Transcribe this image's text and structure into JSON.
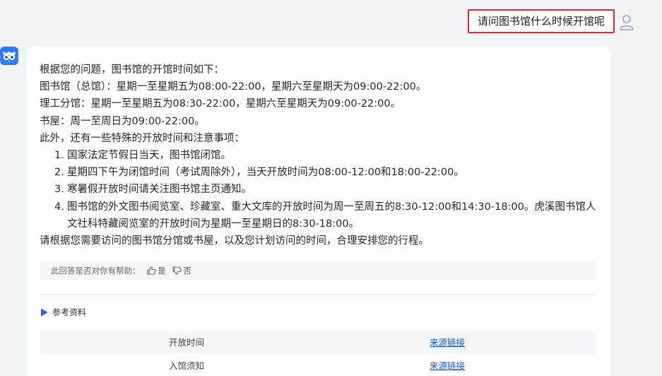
{
  "user": {
    "question": "请问图书馆什么时候开馆呢",
    "avatar_icon": "user-icon"
  },
  "bot": {
    "avatar_icon": "owl-logo-icon"
  },
  "answer": {
    "intro": "根据您的问题，图书馆的开馆时间如下：",
    "lines": [
      "图书馆（总馆）：星期一至星期五为08:00-22:00，星期六至星期天为09:00-22:00。",
      "理工分馆：星期一至星期五为08:30-22:00，星期六至星期天为09:00-22:00。",
      "书屋：周一至周日为09:00-22:00。",
      "此外，还有一些特殊的开放时间和注意事项："
    ],
    "items": [
      {
        "num": "1.",
        "text": "国家法定节假日当天，图书馆闭馆。"
      },
      {
        "num": "2.",
        "text": "星期四下午为闭馆时间（考试周除外），当天开放时间为08:00-12:00和18:00-22:00。"
      },
      {
        "num": "3.",
        "text": "寒暑假开放时间请关注图书馆主页通知。"
      },
      {
        "num": "4.",
        "text": "图书馆的外文图书阅览室、珍藏室、重大文库的开放时间为周一至周五的8:30-12:00和14:30-18:00。虎溪图书馆人文社科特藏阅览室的开放时间为星期一至星期日的8:30-18:00。"
      }
    ],
    "closing": "请根据您需要访问的图书馆分馆或书屋，以及您计划访问的时间，合理安排您的行程。"
  },
  "feedback": {
    "prompt": "此回答是否对你有帮助：",
    "yes_label": "是",
    "no_label": "否"
  },
  "references": {
    "title": "参考资料",
    "rows": [
      {
        "name": "开放时间",
        "link": "来源链接"
      },
      {
        "name": "入馆须知",
        "link": "来源链接"
      }
    ]
  },
  "colors": {
    "highlight_border": "#e8282b",
    "bot_accent": "#2f7bff",
    "link": "#1a56db"
  }
}
